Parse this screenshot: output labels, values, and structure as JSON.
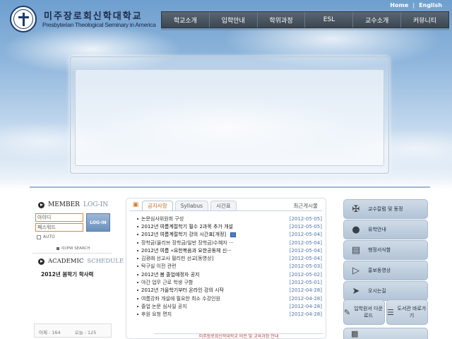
{
  "header": {
    "logo_korean": "미주장로회신학대학교",
    "logo_english": "Presbyterian Theological Seminary in America",
    "utility_links": [
      "Home",
      "English"
    ],
    "nav": [
      "학교소개",
      "입학안내",
      "학위과정",
      "ESL",
      "교수소개",
      "커뮤니티"
    ]
  },
  "member": {
    "title_bold": "MEMBER",
    "title_light": "LOG-IN",
    "id_placeholder": "아이디",
    "pw_placeholder": "패스워드",
    "login_button": "LOG-IN",
    "auto_label": "AUTO",
    "idpw_search": "ID/PW SEARCH"
  },
  "academic": {
    "title_bold": "ACADEMIC",
    "title_light": "SCHEDULE",
    "link": "2012년 봄학기 학사력"
  },
  "counter": {
    "yesterday": "어제 : 164",
    "today": "오늘 : 125"
  },
  "board": {
    "tabs": [
      "공지사항",
      "Syllabus",
      "시간표"
    ],
    "active_tab": "공지사항",
    "recent_label": "최근게시물",
    "items": [
      {
        "title": "논문심사위원회 구성",
        "date": "[2012-05-05]"
      },
      {
        "title": "2012년 여름계절학기 필수 2과목 추가 개설",
        "date": "[2012-05-05]"
      },
      {
        "title": "2012년 여름계절학기 강의 시간표[개정]",
        "date": "[2012-05-04]"
      },
      {
        "title": "장학금(올리브 장학금/일반 장학금)수혜자 ···",
        "date": "[2012-05-04]"
      },
      {
        "title": "2012년 여름 «요한복음과 요한공동체 신···",
        "date": "[2012-05-04]"
      },
      {
        "title": "김광래 선교사 필리핀 선교[동영상]",
        "date": "[2012-05-04]"
      },
      {
        "title": "탁구실 이전 관련",
        "date": "[2012-05-03]"
      },
      {
        "title": "2012년 봄 졸업예정자 공지",
        "date": "[2012-05-02]"
      },
      {
        "title": "야간 업무 근로 학생 구함",
        "date": "[2012-05-01]"
      },
      {
        "title": "2012년 가을학기부터 온라인 강의 시작",
        "date": "[2012-04-28]"
      },
      {
        "title": "여름강좌 개설에 필요한 최소 수강인원",
        "date": "[2012-04-28]"
      },
      {
        "title": "졸업 논문 심사일 공지",
        "date": "[2012-04-28]"
      },
      {
        "title": "후원 요청 편지",
        "date": "[2012-04-28]"
      }
    ],
    "bottom_text": "미주장로회신학대학교 비전 및 교육과정 안내"
  },
  "quick_menu": {
    "items": [
      {
        "label": "교수칼럼 및 동정",
        "icon": "person-icon"
      },
      {
        "label": "유학안내",
        "icon": "man-icon"
      },
      {
        "label": "행정서식함",
        "icon": "folder-icon"
      },
      {
        "label": "홍보동영상",
        "icon": "video-icon"
      },
      {
        "label": "오시는길",
        "icon": "map-pin-icon"
      }
    ],
    "pair": [
      {
        "label": "입학원서 다운로드",
        "icon": "document-icon"
      },
      {
        "label": "도서관 바로가기",
        "icon": "book-icon"
      }
    ]
  }
}
